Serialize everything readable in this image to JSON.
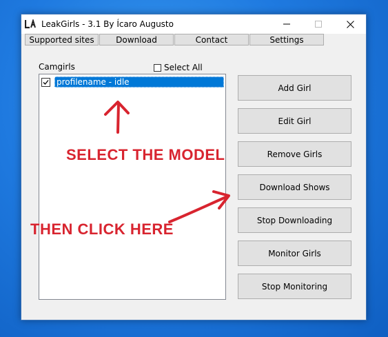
{
  "window": {
    "title": "LeakGirls - 3.1 By Ícaro Augusto",
    "icon": "app-logo-icon",
    "controls": [
      "minimize-icon",
      "maximize-icon",
      "close-icon"
    ]
  },
  "tabs": [
    {
      "label": "Supported sites"
    },
    {
      "label": "Download"
    },
    {
      "label": "Contact"
    },
    {
      "label": "Settings"
    }
  ],
  "camgirls": {
    "label": "Camgirls",
    "select_all_label": "Select All",
    "select_all_checked": false,
    "items": [
      {
        "label": "profilename - idle",
        "checked": true,
        "selected": true
      }
    ]
  },
  "actions": [
    {
      "label": "Add Girl"
    },
    {
      "label": "Edit Girl"
    },
    {
      "label": "Remove Girls"
    },
    {
      "label": "Download Shows"
    },
    {
      "label": "Stop Downloading"
    },
    {
      "label": "Monitor Girls"
    },
    {
      "label": "Stop Monitoring"
    }
  ],
  "annotations": {
    "select_model": "SELECT THE MODEL",
    "then_click": "THEN CLICK HERE",
    "color": "#d8242f"
  },
  "colors": {
    "selection": "#0078d7",
    "button_face": "#e1e1e1",
    "window_bg": "#f0f0f0"
  }
}
